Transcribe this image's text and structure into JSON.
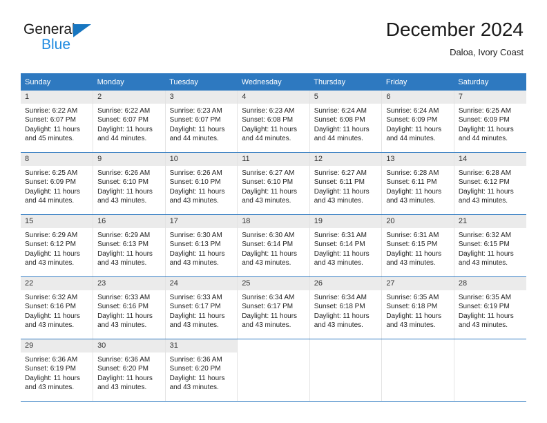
{
  "brand": {
    "name_top": "General",
    "name_bottom": "Blue",
    "triangle_color": "#1776c0",
    "blue_text_color": "#1f8ae0"
  },
  "header": {
    "title": "December 2024",
    "subtitle": "Daloa, Ivory Coast"
  },
  "colors": {
    "header_row_background": "#2e79c0",
    "header_row_text": "#ffffff",
    "daynumber_band": "#ebebeb",
    "cell_background": "#ffffff",
    "row_divider": "#2e79c0",
    "column_divider": "#e3e3e3"
  },
  "weekday_headers": [
    "Sunday",
    "Monday",
    "Tuesday",
    "Wednesday",
    "Thursday",
    "Friday",
    "Saturday"
  ],
  "weeks": [
    [
      {
        "day": "1",
        "sunrise": "Sunrise: 6:22 AM",
        "sunset": "Sunset: 6:07 PM",
        "daylight_line1": "Daylight: 11 hours",
        "daylight_line2": "and 45 minutes."
      },
      {
        "day": "2",
        "sunrise": "Sunrise: 6:22 AM",
        "sunset": "Sunset: 6:07 PM",
        "daylight_line1": "Daylight: 11 hours",
        "daylight_line2": "and 44 minutes."
      },
      {
        "day": "3",
        "sunrise": "Sunrise: 6:23 AM",
        "sunset": "Sunset: 6:07 PM",
        "daylight_line1": "Daylight: 11 hours",
        "daylight_line2": "and 44 minutes."
      },
      {
        "day": "4",
        "sunrise": "Sunrise: 6:23 AM",
        "sunset": "Sunset: 6:08 PM",
        "daylight_line1": "Daylight: 11 hours",
        "daylight_line2": "and 44 minutes."
      },
      {
        "day": "5",
        "sunrise": "Sunrise: 6:24 AM",
        "sunset": "Sunset: 6:08 PM",
        "daylight_line1": "Daylight: 11 hours",
        "daylight_line2": "and 44 minutes."
      },
      {
        "day": "6",
        "sunrise": "Sunrise: 6:24 AM",
        "sunset": "Sunset: 6:09 PM",
        "daylight_line1": "Daylight: 11 hours",
        "daylight_line2": "and 44 minutes."
      },
      {
        "day": "7",
        "sunrise": "Sunrise: 6:25 AM",
        "sunset": "Sunset: 6:09 PM",
        "daylight_line1": "Daylight: 11 hours",
        "daylight_line2": "and 44 minutes."
      }
    ],
    [
      {
        "day": "8",
        "sunrise": "Sunrise: 6:25 AM",
        "sunset": "Sunset: 6:09 PM",
        "daylight_line1": "Daylight: 11 hours",
        "daylight_line2": "and 44 minutes."
      },
      {
        "day": "9",
        "sunrise": "Sunrise: 6:26 AM",
        "sunset": "Sunset: 6:10 PM",
        "daylight_line1": "Daylight: 11 hours",
        "daylight_line2": "and 43 minutes."
      },
      {
        "day": "10",
        "sunrise": "Sunrise: 6:26 AM",
        "sunset": "Sunset: 6:10 PM",
        "daylight_line1": "Daylight: 11 hours",
        "daylight_line2": "and 43 minutes."
      },
      {
        "day": "11",
        "sunrise": "Sunrise: 6:27 AM",
        "sunset": "Sunset: 6:10 PM",
        "daylight_line1": "Daylight: 11 hours",
        "daylight_line2": "and 43 minutes."
      },
      {
        "day": "12",
        "sunrise": "Sunrise: 6:27 AM",
        "sunset": "Sunset: 6:11 PM",
        "daylight_line1": "Daylight: 11 hours",
        "daylight_line2": "and 43 minutes."
      },
      {
        "day": "13",
        "sunrise": "Sunrise: 6:28 AM",
        "sunset": "Sunset: 6:11 PM",
        "daylight_line1": "Daylight: 11 hours",
        "daylight_line2": "and 43 minutes."
      },
      {
        "day": "14",
        "sunrise": "Sunrise: 6:28 AM",
        "sunset": "Sunset: 6:12 PM",
        "daylight_line1": "Daylight: 11 hours",
        "daylight_line2": "and 43 minutes."
      }
    ],
    [
      {
        "day": "15",
        "sunrise": "Sunrise: 6:29 AM",
        "sunset": "Sunset: 6:12 PM",
        "daylight_line1": "Daylight: 11 hours",
        "daylight_line2": "and 43 minutes."
      },
      {
        "day": "16",
        "sunrise": "Sunrise: 6:29 AM",
        "sunset": "Sunset: 6:13 PM",
        "daylight_line1": "Daylight: 11 hours",
        "daylight_line2": "and 43 minutes."
      },
      {
        "day": "17",
        "sunrise": "Sunrise: 6:30 AM",
        "sunset": "Sunset: 6:13 PM",
        "daylight_line1": "Daylight: 11 hours",
        "daylight_line2": "and 43 minutes."
      },
      {
        "day": "18",
        "sunrise": "Sunrise: 6:30 AM",
        "sunset": "Sunset: 6:14 PM",
        "daylight_line1": "Daylight: 11 hours",
        "daylight_line2": "and 43 minutes."
      },
      {
        "day": "19",
        "sunrise": "Sunrise: 6:31 AM",
        "sunset": "Sunset: 6:14 PM",
        "daylight_line1": "Daylight: 11 hours",
        "daylight_line2": "and 43 minutes."
      },
      {
        "day": "20",
        "sunrise": "Sunrise: 6:31 AM",
        "sunset": "Sunset: 6:15 PM",
        "daylight_line1": "Daylight: 11 hours",
        "daylight_line2": "and 43 minutes."
      },
      {
        "day": "21",
        "sunrise": "Sunrise: 6:32 AM",
        "sunset": "Sunset: 6:15 PM",
        "daylight_line1": "Daylight: 11 hours",
        "daylight_line2": "and 43 minutes."
      }
    ],
    [
      {
        "day": "22",
        "sunrise": "Sunrise: 6:32 AM",
        "sunset": "Sunset: 6:16 PM",
        "daylight_line1": "Daylight: 11 hours",
        "daylight_line2": "and 43 minutes."
      },
      {
        "day": "23",
        "sunrise": "Sunrise: 6:33 AM",
        "sunset": "Sunset: 6:16 PM",
        "daylight_line1": "Daylight: 11 hours",
        "daylight_line2": "and 43 minutes."
      },
      {
        "day": "24",
        "sunrise": "Sunrise: 6:33 AM",
        "sunset": "Sunset: 6:17 PM",
        "daylight_line1": "Daylight: 11 hours",
        "daylight_line2": "and 43 minutes."
      },
      {
        "day": "25",
        "sunrise": "Sunrise: 6:34 AM",
        "sunset": "Sunset: 6:17 PM",
        "daylight_line1": "Daylight: 11 hours",
        "daylight_line2": "and 43 minutes."
      },
      {
        "day": "26",
        "sunrise": "Sunrise: 6:34 AM",
        "sunset": "Sunset: 6:18 PM",
        "daylight_line1": "Daylight: 11 hours",
        "daylight_line2": "and 43 minutes."
      },
      {
        "day": "27",
        "sunrise": "Sunrise: 6:35 AM",
        "sunset": "Sunset: 6:18 PM",
        "daylight_line1": "Daylight: 11 hours",
        "daylight_line2": "and 43 minutes."
      },
      {
        "day": "28",
        "sunrise": "Sunrise: 6:35 AM",
        "sunset": "Sunset: 6:19 PM",
        "daylight_line1": "Daylight: 11 hours",
        "daylight_line2": "and 43 minutes."
      }
    ],
    [
      {
        "day": "29",
        "sunrise": "Sunrise: 6:36 AM",
        "sunset": "Sunset: 6:19 PM",
        "daylight_line1": "Daylight: 11 hours",
        "daylight_line2": "and 43 minutes."
      },
      {
        "day": "30",
        "sunrise": "Sunrise: 6:36 AM",
        "sunset": "Sunset: 6:20 PM",
        "daylight_line1": "Daylight: 11 hours",
        "daylight_line2": "and 43 minutes."
      },
      {
        "day": "31",
        "sunrise": "Sunrise: 6:36 AM",
        "sunset": "Sunset: 6:20 PM",
        "daylight_line1": "Daylight: 11 hours",
        "daylight_line2": "and 43 minutes."
      },
      {
        "day": "",
        "sunrise": "",
        "sunset": "",
        "daylight_line1": "",
        "daylight_line2": ""
      },
      {
        "day": "",
        "sunrise": "",
        "sunset": "",
        "daylight_line1": "",
        "daylight_line2": ""
      },
      {
        "day": "",
        "sunrise": "",
        "sunset": "",
        "daylight_line1": "",
        "daylight_line2": ""
      },
      {
        "day": "",
        "sunrise": "",
        "sunset": "",
        "daylight_line1": "",
        "daylight_line2": ""
      }
    ]
  ]
}
